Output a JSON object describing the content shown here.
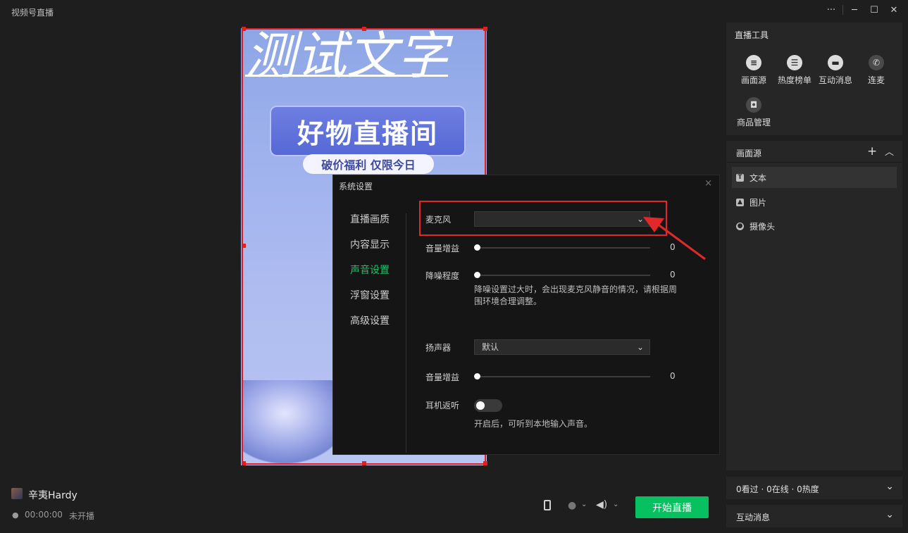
{
  "app": {
    "title": "视频号直播",
    "controls": {
      "more": "···",
      "minimize": "─",
      "maximize": "☐",
      "close": "✕"
    }
  },
  "preview": {
    "overlay_text": "测试文字",
    "banner_title": "好物直播间",
    "banner_subtitle": "破价福利 仅限今日"
  },
  "settings_dialog": {
    "title": "系统设置",
    "close": "×",
    "nav": [
      {
        "label": "直播画质",
        "active": false
      },
      {
        "label": "内容显示",
        "active": false
      },
      {
        "label": "声音设置",
        "active": true
      },
      {
        "label": "浮窗设置",
        "active": false
      },
      {
        "label": "高级设置",
        "active": false
      }
    ],
    "microphone": {
      "label": "麦克风",
      "value": ""
    },
    "mic_gain": {
      "label": "音量增益",
      "value": "0",
      "fraction": 0
    },
    "noise": {
      "label": "降噪程度",
      "value": "0",
      "fraction": 0,
      "hint": "降噪设置过大时，会出现麦克风静音的情况，请根据周围环境合理调整。"
    },
    "speaker": {
      "label": "扬声器",
      "value": "默认"
    },
    "speaker_gain": {
      "label": "音量增益",
      "value": "0",
      "fraction": 0
    },
    "earback": {
      "label": "耳机返听",
      "on": false,
      "hint": "开启后，可听到本地输入声音。"
    }
  },
  "tools": {
    "title": "直播工具",
    "items": [
      {
        "label": "画面源",
        "icon": "document-icon"
      },
      {
        "label": "热度榜单",
        "icon": "list-icon"
      },
      {
        "label": "互动消息",
        "icon": "chat-icon"
      },
      {
        "label": "连麦",
        "icon": "phone-icon"
      },
      {
        "label": "商品管理",
        "icon": "shopping-bag-icon"
      }
    ]
  },
  "sources": {
    "title": "画面源",
    "add": "+",
    "collapse": "︿",
    "items": [
      {
        "label": "文本",
        "icon": "text-icon",
        "active": true
      },
      {
        "label": "图片",
        "icon": "image-icon",
        "active": false
      },
      {
        "label": "摄像头",
        "icon": "camera-icon",
        "active": false
      }
    ]
  },
  "stats": {
    "text": "0看过 · 0在线 · 0热度"
  },
  "messages": {
    "title": "互动消息"
  },
  "user": {
    "name": "辛夷Hardy",
    "timer": "00:00:00",
    "status": "未开播"
  },
  "controls": {
    "start_label": "开始直播"
  },
  "colors": {
    "accent_green": "#07c160",
    "active_nav": "#21c16b",
    "highlight_red": "#e22828"
  }
}
